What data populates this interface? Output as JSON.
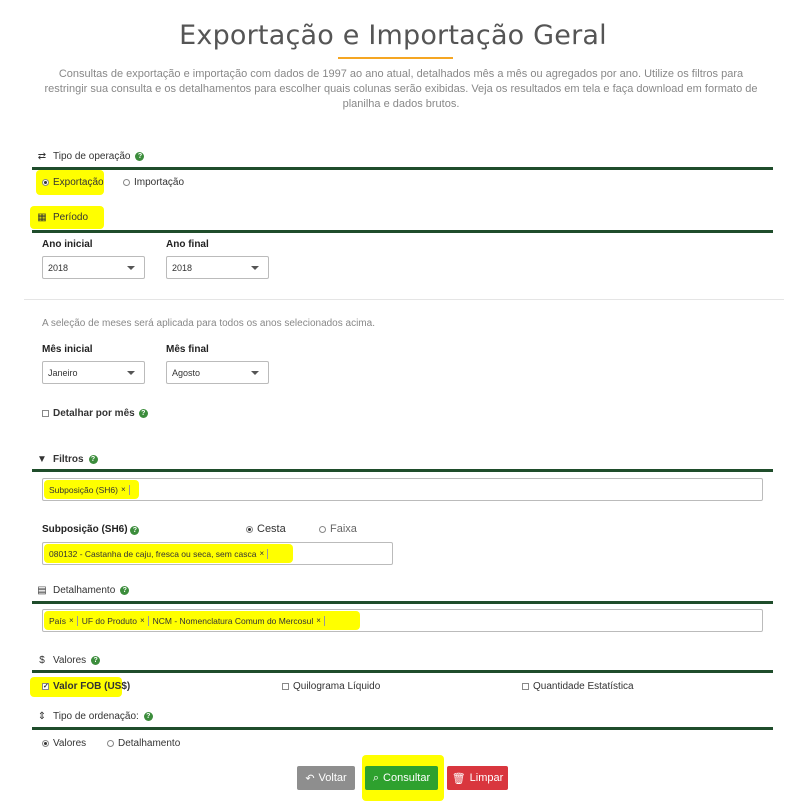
{
  "header": {
    "title": "Exportação e Importação Geral",
    "description": "Consultas de exportação e importação com dados de 1997 ao ano atual, detalhados mês a mês ou agregados por ano. Utilize os filtros para restringir sua consulta e os detalhamentos para escolher quais colunas serão exibidas. Veja os resultados em tela e faça download em formato de planilha e dados brutos."
  },
  "tipo_operacao": {
    "label": "Tipo de operação",
    "options": [
      "Exportação",
      "Importação"
    ],
    "selected": "Exportação"
  },
  "periodo": {
    "label": "Período",
    "ano_inicial_label": "Ano inicial",
    "ano_inicial": "2018",
    "ano_final_label": "Ano final",
    "ano_final": "2018",
    "note": "A seleção de meses será aplicada para todos os anos selecionados acima.",
    "mes_inicial_label": "Mês inicial",
    "mes_inicial": "Janeiro",
    "mes_final_label": "Mês final",
    "mes_final": "Agosto",
    "detalhar_label": "Detalhar por mês"
  },
  "filtros": {
    "label": "Filtros",
    "tags": [
      "Subposição (SH6)"
    ],
    "sub_label": "Subposição (SH6)",
    "mode_options": [
      "Cesta",
      "Faixa"
    ],
    "mode_selected": "Cesta",
    "selected_items": [
      "080132 - Castanha de caju, fresca ou seca, sem casca"
    ]
  },
  "detalhamento": {
    "label": "Detalhamento",
    "tags": [
      "País",
      "UF do Produto",
      "NCM - Nomenclatura Comum do Mercosul"
    ]
  },
  "valores": {
    "label": "Valores",
    "options": [
      "Valor FOB (US$)",
      "Quilograma Líquido",
      "Quantidade Estatística"
    ],
    "checked": [
      true,
      false,
      false
    ]
  },
  "ordenacao": {
    "label": "Tipo de ordenação:",
    "options": [
      "Valores",
      "Detalhamento"
    ],
    "selected": "Valores"
  },
  "buttons": {
    "voltar": "Voltar",
    "consultar": "Consultar",
    "limpar": "Limpar"
  },
  "colors": {
    "highlight": "#ffff00",
    "section_bar": "#1f4d2b",
    "consultar": "#2ea12e",
    "limpar": "#d9363e",
    "voltar": "#8e8e8e",
    "title_underline": "#f5a623"
  },
  "icons": {
    "tipo_operacao": "exchange-icon",
    "periodo": "calendar-icon",
    "filtros": "filter-icon",
    "detalhamento": "table-icon",
    "valores": "dollar-icon",
    "ordenacao": "sort-icon",
    "help": "question-circle-icon"
  }
}
